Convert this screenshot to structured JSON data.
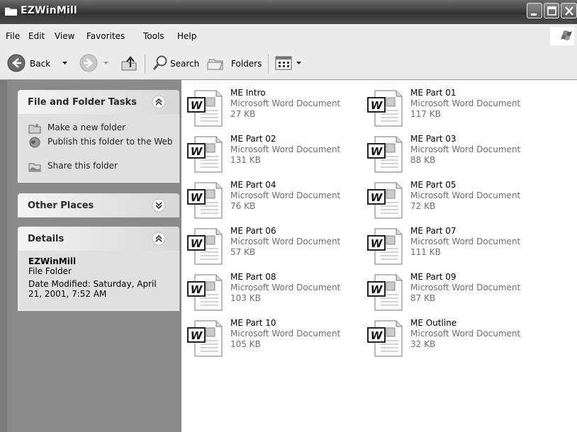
{
  "window": {
    "title": "EZWinMill"
  },
  "menu": [
    "File",
    "Edit",
    "View",
    "Favorites",
    "Tools",
    "Help"
  ],
  "toolbar": {
    "back_label": "Back",
    "search_label": "Search",
    "folders_label": "Folders"
  },
  "tasks_panel": {
    "title": "File and Folder Tasks",
    "items": [
      "Make a new folder",
      "Publish this folder to the Web",
      "Share this folder"
    ]
  },
  "other_places": {
    "title": "Other Places"
  },
  "details": {
    "title": "Details",
    "name": "EZWinMill",
    "type": "File Folder",
    "modified": "Date Modified: Saturday, April 21, 2001, 7:52 AM"
  },
  "files": [
    {
      "name": "ME Intro",
      "type": "Microsoft Word Document",
      "size": "27 KB"
    },
    {
      "name": "ME Part 01",
      "type": "Microsoft Word Document",
      "size": "117 KB"
    },
    {
      "name": "ME Part 02",
      "type": "Microsoft Word Document",
      "size": "131 KB"
    },
    {
      "name": "ME Part 03",
      "type": "Microsoft Word Document",
      "size": "88 KB"
    },
    {
      "name": "ME Part 04",
      "type": "Microsoft Word Document",
      "size": "76 KB"
    },
    {
      "name": "ME Part 05",
      "type": "Microsoft Word Document",
      "size": "72 KB"
    },
    {
      "name": "ME Part 06",
      "type": "Microsoft Word Document",
      "size": "57 KB"
    },
    {
      "name": "ME Part 07",
      "type": "Microsoft Word Document",
      "size": "111 KB"
    },
    {
      "name": "ME Part 08",
      "type": "Microsoft Word Document",
      "size": "103 KB"
    },
    {
      "name": "ME Part 09",
      "type": "Microsoft Word Document",
      "size": "87 KB"
    },
    {
      "name": "ME Part 10",
      "type": "Microsoft Word Document",
      "size": "105 KB"
    },
    {
      "name": "ME Outline",
      "type": "Microsoft Word Document",
      "size": "32 KB"
    }
  ]
}
